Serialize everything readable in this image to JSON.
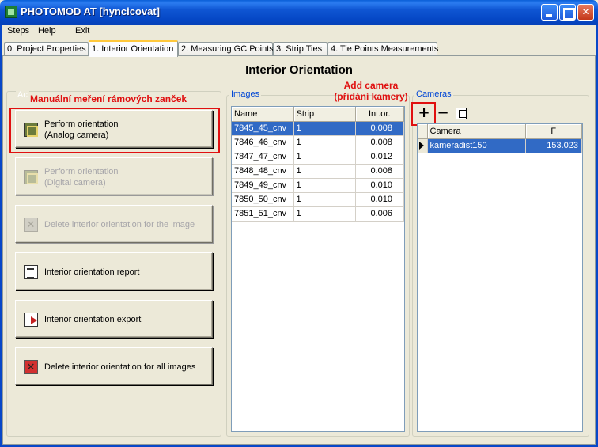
{
  "window": {
    "title": "PHOTOMOD AT [hyncicovat]"
  },
  "menu": [
    "Steps",
    "Help",
    "Exit"
  ],
  "tabs": [
    {
      "label": "0. Project Properties",
      "active": false
    },
    {
      "label": "1. Interior Orientation",
      "active": true
    },
    {
      "label": "2. Measuring GC Points",
      "active": false
    },
    {
      "label": "3. Strip Ties",
      "active": false
    },
    {
      "label": "4. Tie Points Measurements",
      "active": false
    }
  ],
  "page_title": "Interior Orientation",
  "actions": {
    "group_label": "Ac",
    "buttons": [
      {
        "label": "Perform orientation\n(Analog camera)",
        "icon": "orientation-icon",
        "enabled": true
      },
      {
        "label": "Perform orientation\n(Digital camera)",
        "icon": "orientation-icon",
        "enabled": false
      },
      {
        "label": "Delete interior orientation for the image",
        "icon": "delete-icon",
        "enabled": false
      },
      {
        "label": "Interior orientation report",
        "icon": "report-icon",
        "enabled": true
      },
      {
        "label": "Interior orientation export",
        "icon": "export-icon",
        "enabled": true
      },
      {
        "label": "Delete interior orientation for all images",
        "icon": "delete-all-icon",
        "enabled": true
      }
    ]
  },
  "annotations": {
    "manual": "Manuální meření rámových zanček",
    "add_camera": "Add camera\n(přidání kamery)"
  },
  "images": {
    "group_label": "Images",
    "columns": [
      "Name",
      "Strip",
      "Int.or."
    ],
    "rows": [
      {
        "name": "7845_45_cnv",
        "strip": "1",
        "int_or": "0.008",
        "selected": true
      },
      {
        "name": "7846_46_cnv",
        "strip": "1",
        "int_or": "0.008"
      },
      {
        "name": "7847_47_cnv",
        "strip": "1",
        "int_or": "0.012"
      },
      {
        "name": "7848_48_cnv",
        "strip": "1",
        "int_or": "0.008"
      },
      {
        "name": "7849_49_cnv",
        "strip": "1",
        "int_or": "0.010"
      },
      {
        "name": "7850_50_cnv",
        "strip": "1",
        "int_or": "0.010"
      },
      {
        "name": "7851_51_cnv",
        "strip": "1",
        "int_or": "0.006"
      }
    ]
  },
  "cameras": {
    "group_label": "Cameras",
    "tools": {
      "add": "+",
      "remove": "−"
    },
    "columns": [
      "Camera",
      "F"
    ],
    "rows": [
      {
        "camera": "kameradist150",
        "f": "153.023",
        "selected": true
      }
    ]
  },
  "colors": {
    "annotation": "#E01010",
    "selection": "#316AC5",
    "group_label": "#0046D5"
  }
}
